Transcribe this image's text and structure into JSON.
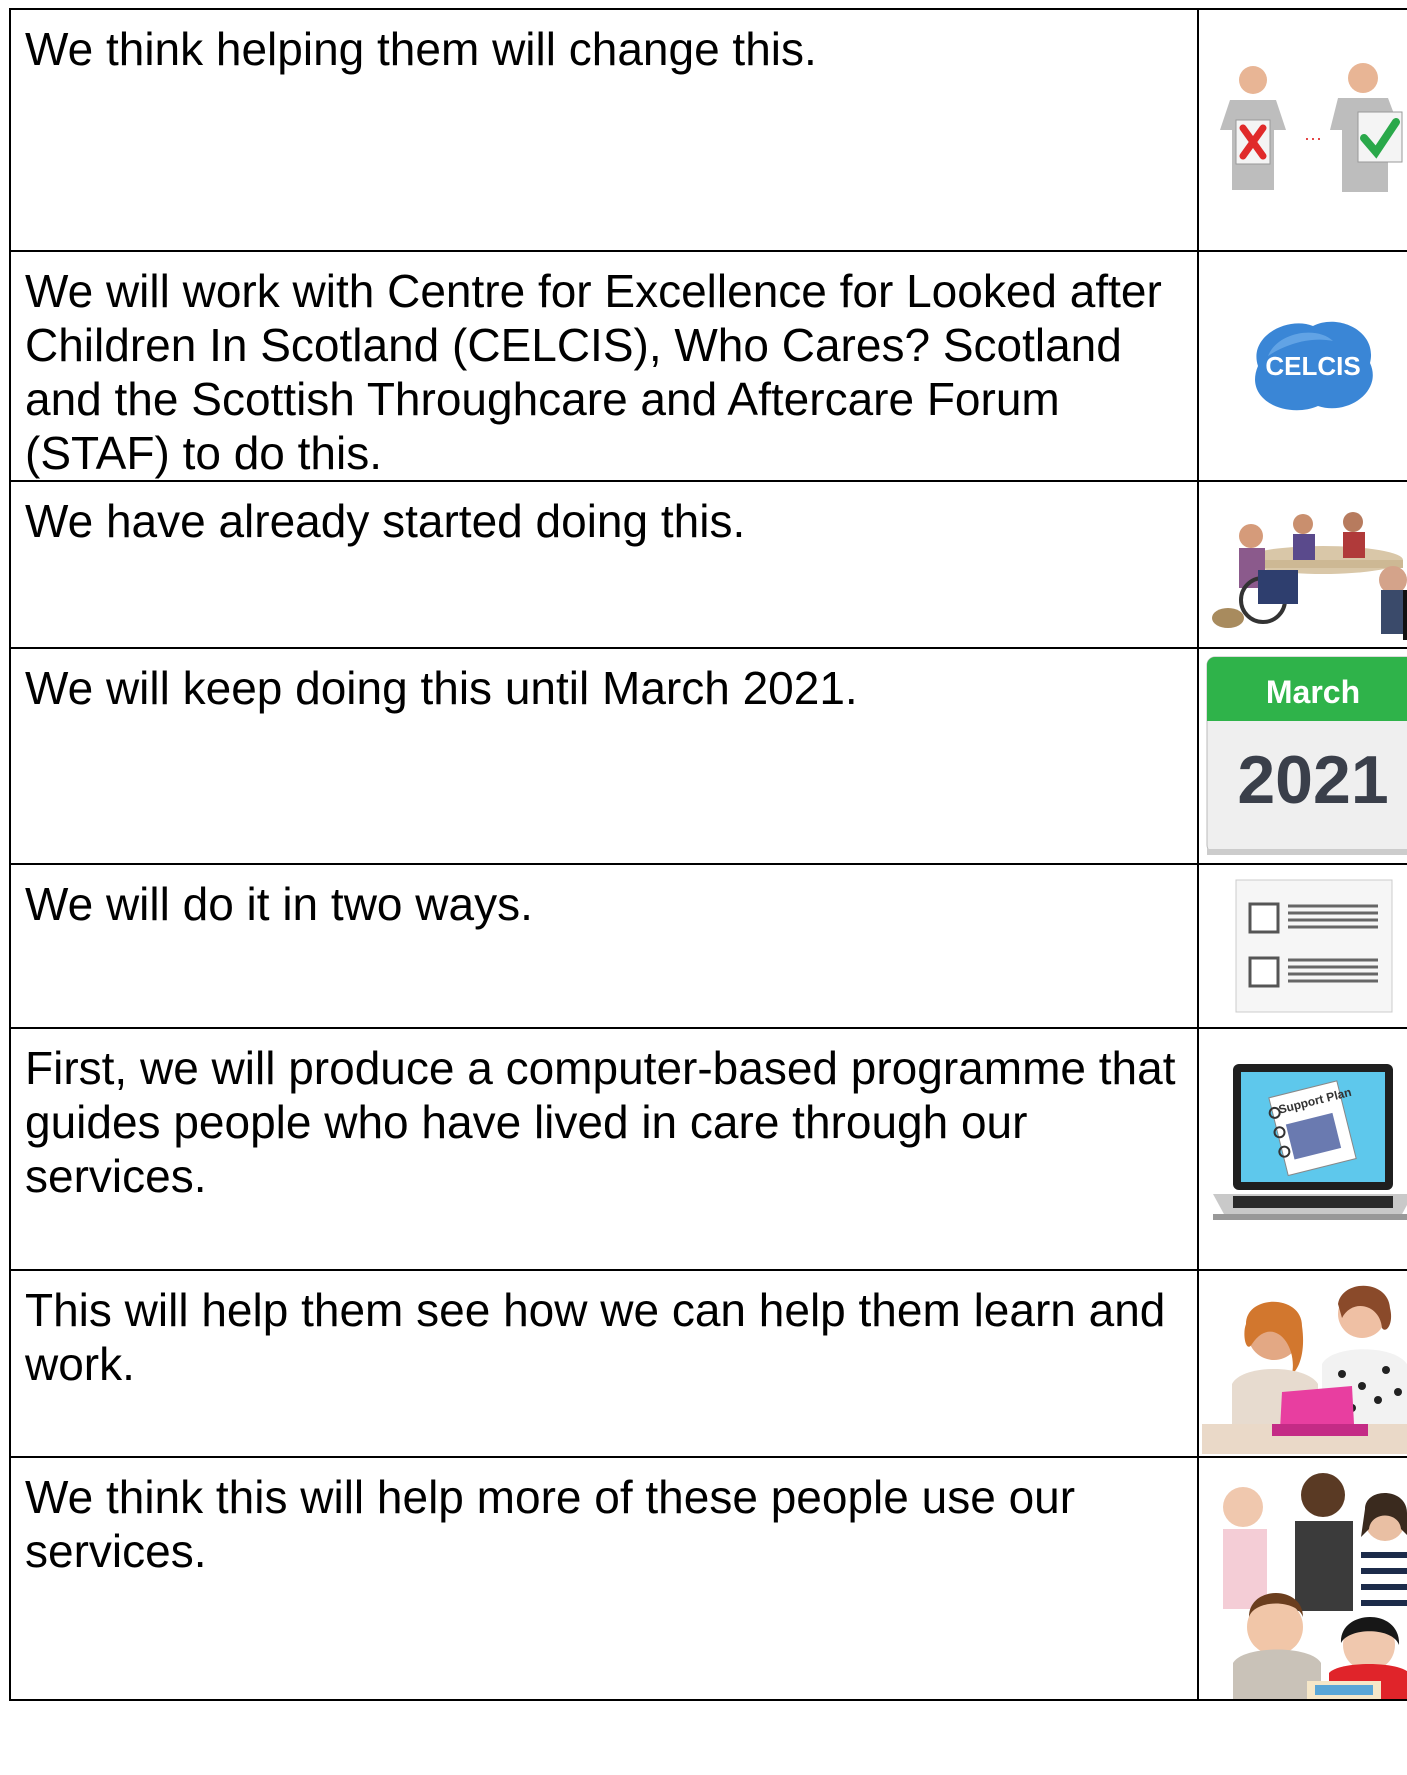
{
  "rows": [
    {
      "text": "We think helping them will change this.",
      "image": "change-bad-to-good-picture"
    },
    {
      "text": "We will work with Centre for Excellence for Looked after Children In Scotland (CELCIS), Who Cares? Scotland and the Scottish Throughcare and Aftercare Forum (STAF) to do this.",
      "image": "celcis-logo",
      "logo_text": "CELCIS"
    },
    {
      "text": "We have already started doing this.",
      "image": "group-meeting-picture"
    },
    {
      "text": "We will keep doing this until March 2021.",
      "image": "calendar-icon",
      "calendar_month": "March",
      "calendar_year": "2021"
    },
    {
      "text": "We will do it in two ways.",
      "image": "checklist-icon"
    },
    {
      "text": "First, we will produce a computer-based programme that guides people who have lived in care through our services.",
      "image": "laptop-support-plan-picture",
      "screen_text": "Support Plan"
    },
    {
      "text": "This will help them see how we can help them learn and work.",
      "image": "two-people-tablet-picture"
    },
    {
      "text": "We think this will help more of these people use our services.",
      "image": "group-of-people-picture"
    }
  ],
  "colors": {
    "celcis_blue": "#3a86d6",
    "calendar_green": "#2fb34a",
    "tick_green": "#2aa84a",
    "cross_red": "#e02a2a",
    "tablet_pink": "#e83ea0"
  }
}
